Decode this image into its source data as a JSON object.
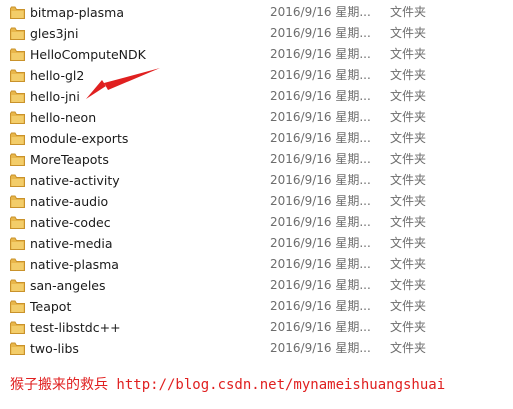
{
  "colors": {
    "folder": "#e8b64a",
    "folder_dark": "#c9922b",
    "annotation": "#e02020"
  },
  "items": [
    {
      "name": "bitmap-plasma",
      "date": "2016/9/16 星期...",
      "type": "文件夹"
    },
    {
      "name": "gles3jni",
      "date": "2016/9/16 星期...",
      "type": "文件夹"
    },
    {
      "name": "HelloComputeNDK",
      "date": "2016/9/16 星期...",
      "type": "文件夹"
    },
    {
      "name": "hello-gl2",
      "date": "2016/9/16 星期...",
      "type": "文件夹"
    },
    {
      "name": "hello-jni",
      "date": "2016/9/16 星期...",
      "type": "文件夹"
    },
    {
      "name": "hello-neon",
      "date": "2016/9/16 星期...",
      "type": "文件夹"
    },
    {
      "name": "module-exports",
      "date": "2016/9/16 星期...",
      "type": "文件夹"
    },
    {
      "name": "MoreTeapots",
      "date": "2016/9/16 星期...",
      "type": "文件夹"
    },
    {
      "name": "native-activity",
      "date": "2016/9/16 星期...",
      "type": "文件夹"
    },
    {
      "name": "native-audio",
      "date": "2016/9/16 星期...",
      "type": "文件夹"
    },
    {
      "name": "native-codec",
      "date": "2016/9/16 星期...",
      "type": "文件夹"
    },
    {
      "name": "native-media",
      "date": "2016/9/16 星期...",
      "type": "文件夹"
    },
    {
      "name": "native-plasma",
      "date": "2016/9/16 星期...",
      "type": "文件夹"
    },
    {
      "name": "san-angeles",
      "date": "2016/9/16 星期...",
      "type": "文件夹"
    },
    {
      "name": "Teapot",
      "date": "2016/9/16 星期...",
      "type": "文件夹"
    },
    {
      "name": "test-libstdc++",
      "date": "2016/9/16 星期...",
      "type": "文件夹"
    },
    {
      "name": "two-libs",
      "date": "2016/9/16 星期...",
      "type": "文件夹"
    }
  ],
  "footer": {
    "text": "猴子搬来的救兵 http://blog.csdn.net/mynameishuangshuai"
  }
}
